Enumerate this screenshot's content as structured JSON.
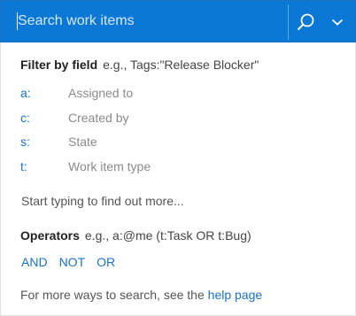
{
  "search": {
    "placeholder": "Search work items",
    "value": ""
  },
  "icons": {
    "search": "search-icon",
    "dropdown": "chevron-down-icon"
  },
  "colors": {
    "header_bg": "#0a78d4",
    "link": "#1a73c8"
  },
  "filter": {
    "title": "Filter by field",
    "example": "e.g., Tags:\"Release Blocker\"",
    "fields": [
      {
        "key": "a:",
        "label": "Assigned to"
      },
      {
        "key": "c:",
        "label": "Created by"
      },
      {
        "key": "s:",
        "label": "State"
      },
      {
        "key": "t:",
        "label": "Work item type"
      }
    ]
  },
  "hint": "Start typing to find out more...",
  "operators": {
    "title": "Operators",
    "example": "e.g., a:@me (t:Task OR t:Bug)",
    "items": [
      "AND",
      "NOT",
      "OR"
    ]
  },
  "footer": {
    "text": "For more ways to search, see the",
    "link": "help page"
  }
}
